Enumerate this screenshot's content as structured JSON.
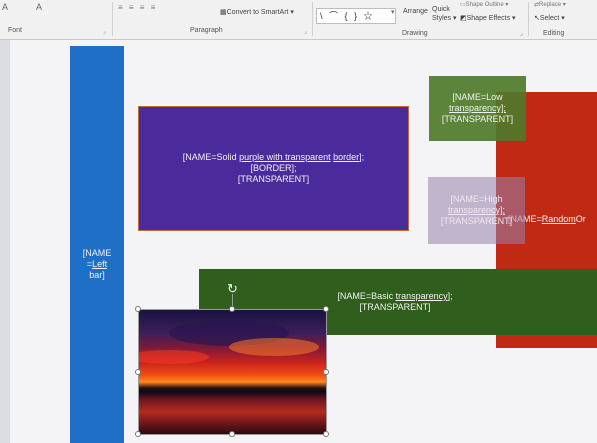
{
  "ribbon": {
    "groups": {
      "font": "Font",
      "paragraph": "Paragraph",
      "drawing": "Drawing",
      "editing": "Editing"
    },
    "font_size_glyph": "A",
    "convert_to_smartart": "Convert to SmartArt ▾",
    "arrange": "Arrange",
    "quick_styles": "Quick Styles ▾",
    "shape_outline": "Shape Outline ▾",
    "shape_effects": "Shape Effects ▾",
    "replace": "Replace ▾",
    "select": "Select ▾",
    "shapes_gallery_glyphs": "\\ ⌒ { } ☆"
  },
  "slide": {
    "left_bar": {
      "line1": "[NAME",
      "line2_prefix": "=",
      "line2_link": "Left",
      "line3": "bar]",
      "color": "#1f6fc7"
    },
    "purple_box": {
      "line1_prefix": "[NAME=Solid ",
      "line1_link1": "purple with transparent",
      "line1_mid": " ",
      "line1_link2": "border",
      "line1_suffix": "];",
      "line2": "[BORDER];",
      "line3": "[TRANSPARENT]",
      "color": "#4b2b9b"
    },
    "low_box": {
      "line1": "[NAME=Low",
      "line2": "transparency];",
      "line3": "[TRANSPARENT]",
      "color": "#4f7a2a"
    },
    "high_box": {
      "line1": "[NAME=High",
      "line2": "transparency];",
      "line3": "[TRANSPARENT]"
    },
    "random_box": {
      "label_prefix": "[NAME=",
      "label_link": "Random",
      "label_suffix": " Or",
      "color": "#c02a14"
    },
    "basic_box": {
      "line1_prefix": "[NAME=Basic ",
      "line1_link": "transparency",
      "line1_suffix": "];",
      "line2": "[TRANSPARENT]",
      "color": "#2f5e1d"
    }
  }
}
